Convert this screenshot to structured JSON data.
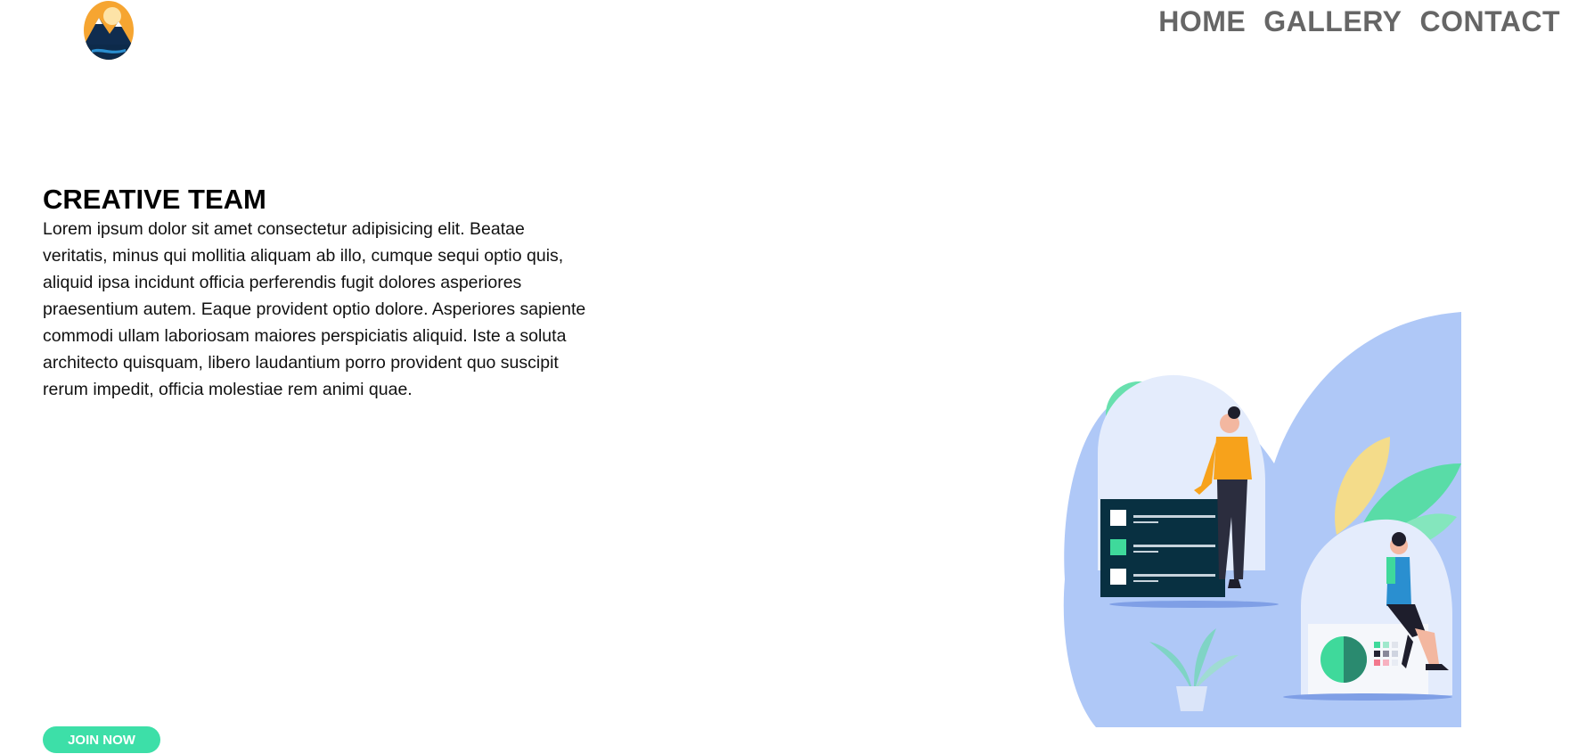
{
  "header": {
    "logo_icon": "mountain-sun-logo-icon",
    "nav": [
      {
        "label": "HOME"
      },
      {
        "label": "GALLERY"
      },
      {
        "label": "CONTACT"
      }
    ]
  },
  "hero": {
    "title": "CREATIVE TEAM",
    "body": "Lorem ipsum dolor sit amet consectetur adipisicing elit. Beatae veritatis, minus qui mollitia aliquam ab illo, cumque sequi optio quis, aliquid ipsa incidunt officia perferendis fugit dolores asperiores praesentium autem. Eaque provident optio dolore. Asperiores sapiente commodi ullam laboriosam maiores perspiciatis aliquid. Iste a soluta architecto quisquam, libero laudantium porro provident quo suscipit rerum impedit, officia molestiae rem animi quae.",
    "cta_label": "JOIN NOW",
    "illustration_icon": "creative-team-illustration"
  },
  "colors": {
    "nav_text": "#666666",
    "cta_background": "#3ddfa8",
    "illustration_blob": "#afc8f7",
    "board_dark": "#083041",
    "accent_green": "#3fd99b",
    "accent_orange": "#f7a21b"
  }
}
